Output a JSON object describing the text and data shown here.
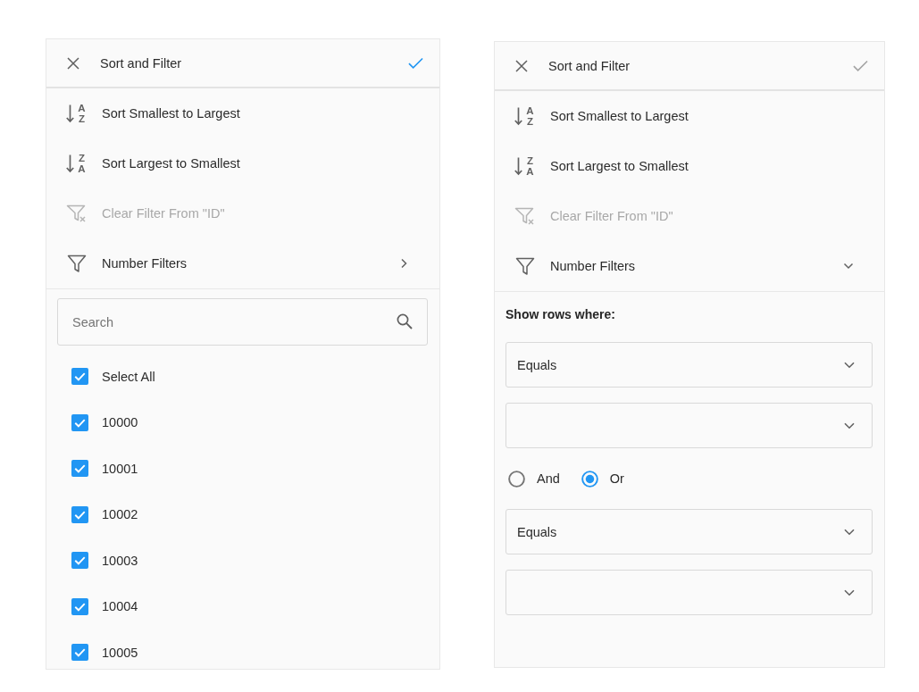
{
  "panels": [
    {
      "header": {
        "title": "Sort and Filter",
        "apply_enabled": true
      },
      "menu": [
        {
          "kind": "sort_ascending",
          "label": "Sort Smallest to Largest",
          "icon_letters": [
            "A",
            "Z"
          ],
          "disabled": false
        },
        {
          "kind": "sort_descending",
          "label": "Sort Largest to Smallest",
          "icon_letters": [
            "Z",
            "A"
          ],
          "disabled": false
        },
        {
          "kind": "clear_filter",
          "label": "Clear Filter From \"ID\"",
          "disabled": true
        },
        {
          "kind": "filter_submenu",
          "label": "Number Filters",
          "disabled": false,
          "expanded": false
        }
      ],
      "search": {
        "placeholder": "Search"
      },
      "checklist": [
        {
          "label": "Select All",
          "checked": true
        },
        {
          "label": "10000",
          "checked": true
        },
        {
          "label": "10001",
          "checked": true
        },
        {
          "label": "10002",
          "checked": true
        },
        {
          "label": "10003",
          "checked": true
        },
        {
          "label": "10004",
          "checked": true
        },
        {
          "label": "10005",
          "checked": true
        }
      ]
    },
    {
      "header": {
        "title": "Sort and Filter",
        "apply_enabled": false
      },
      "menu": [
        {
          "kind": "sort_ascending",
          "label": "Sort Smallest to Largest",
          "icon_letters": [
            "A",
            "Z"
          ],
          "disabled": false
        },
        {
          "kind": "sort_descending",
          "label": "Sort Largest to Smallest",
          "icon_letters": [
            "Z",
            "A"
          ],
          "disabled": false
        },
        {
          "kind": "clear_filter",
          "label": "Clear Filter From \"ID\"",
          "disabled": true
        },
        {
          "kind": "filter_submenu",
          "label": "Number Filters",
          "disabled": false,
          "expanded": true
        }
      ],
      "filter": {
        "heading": "Show rows where:",
        "rows": [
          {
            "kind": "select",
            "value": "Equals"
          },
          {
            "kind": "select"
          },
          {
            "kind": "radio_group",
            "options": [
              {
                "label": "And",
                "selected": false
              },
              {
                "label": "Or",
                "selected": true
              }
            ]
          },
          {
            "kind": "select",
            "value": "Equals"
          },
          {
            "kind": "select"
          }
        ]
      }
    }
  ]
}
